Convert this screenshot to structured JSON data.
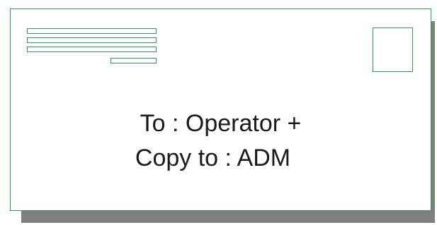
{
  "envelope": {
    "recipient_lines": [
      "To : Operator +",
      "Copy to : ADM"
    ]
  },
  "colors": {
    "outline": "#2e9a5a",
    "shadow": "#7f7f7f",
    "text": "#1a1a1a"
  },
  "icons": {
    "stamp": "stamp-placeholder-icon",
    "sender_address": "address-lines-icon"
  }
}
